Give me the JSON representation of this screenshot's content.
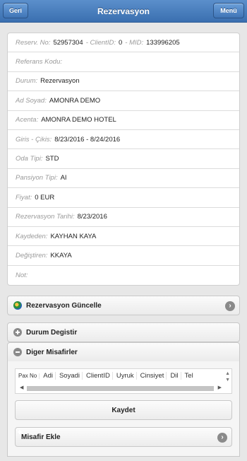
{
  "header": {
    "back_label": "Geri",
    "title": "Rezervasyon",
    "menu_label": "Menü"
  },
  "info": {
    "rows": [
      {
        "label": "Reserv. No:",
        "value": "52957304",
        "extra": [
          {
            "label": "- ClientID:",
            "value": "0"
          },
          {
            "label": "- MID:",
            "value": "133996205"
          }
        ]
      },
      {
        "label": "Referans Kodu:",
        "value": ""
      },
      {
        "label": "Durum:",
        "value": "Rezervasyon"
      },
      {
        "label": "Ad Soyad:",
        "value": "AMONRA DEMO"
      },
      {
        "label": "Acenta:",
        "value": "AMONRA DEMO HOTEL"
      },
      {
        "label": "Giris - Çikis:",
        "value": "8/23/2016 - 8/24/2016"
      },
      {
        "label": "Oda Tipi:",
        "value": "STD"
      },
      {
        "label": "Pansiyon Tipi:",
        "value": "AI"
      },
      {
        "label": "Fiyat:",
        "value": "0 EUR"
      },
      {
        "label": "Rezervasyon Tarihi:",
        "value": "8/23/2016"
      },
      {
        "label": "Kaydeden:",
        "value": "KAYHAN KAYA"
      },
      {
        "label": "Değiştiren:",
        "value": "KKAYA"
      },
      {
        "label": "Not:",
        "value": ""
      }
    ]
  },
  "sections": {
    "update": "Rezervasyon Güncelle",
    "status": "Durum Degistir",
    "guests": "Diger Misafirler"
  },
  "grid": {
    "columns": [
      "Pax No",
      "Adi",
      "Soyadi",
      "ClientID",
      "Uyruk",
      "Cinsiyet",
      "Dil",
      "Tel"
    ]
  },
  "actions": {
    "save_label": "Kaydet",
    "add_guest_label": "Misafir Ekle"
  },
  "colors": {
    "header": "#3a6fb0",
    "add_icon": "#27a844"
  }
}
